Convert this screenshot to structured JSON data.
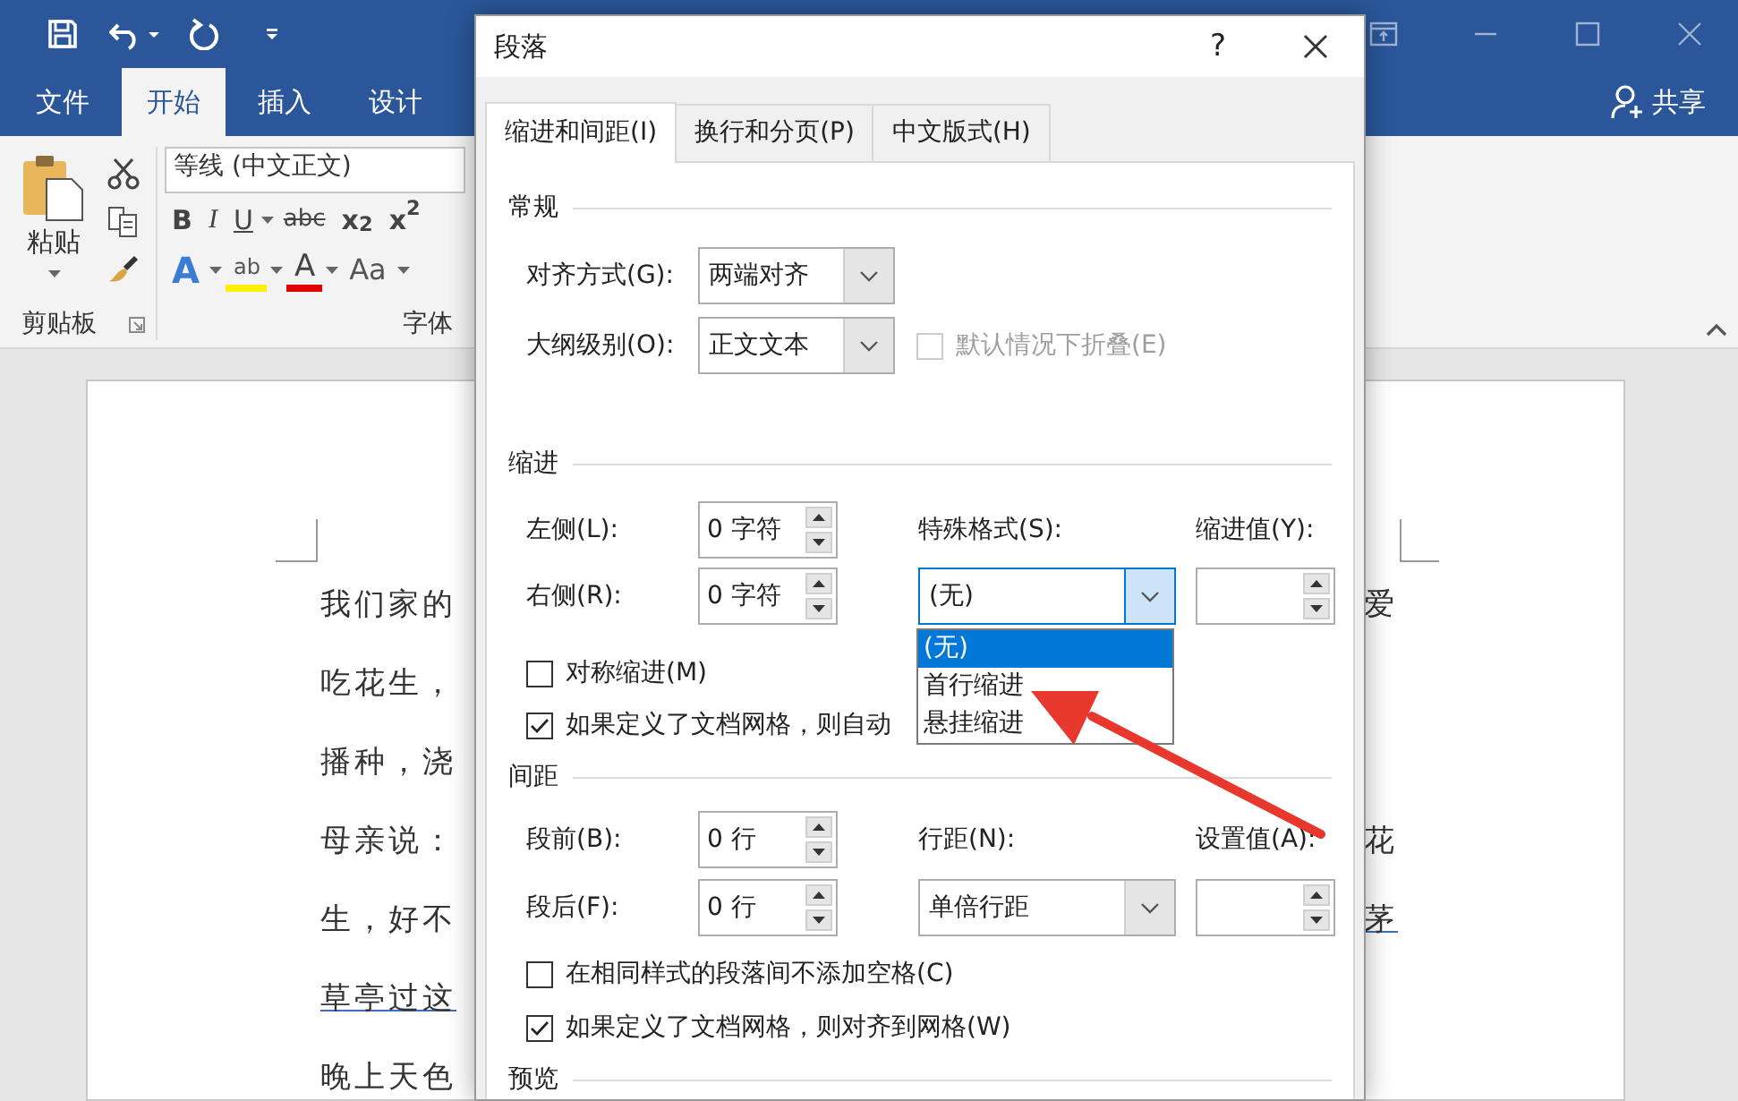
{
  "ribbon_tabs": [
    {
      "label": "文件",
      "selected": false
    },
    {
      "label": "开始",
      "selected": true
    },
    {
      "label": "插入",
      "selected": false
    },
    {
      "label": "设计",
      "selected": false
    }
  ],
  "share": "共享",
  "clipboard": {
    "paste": "粘贴",
    "group_label": "剪贴板"
  },
  "font_group": {
    "font_name": "等线 (中文正文)",
    "group_label": "字体",
    "format_buttons": [
      {
        "text": "B",
        "kind": "bold"
      },
      {
        "text": "I",
        "kind": "italic"
      },
      {
        "text": "U",
        "kind": "underline"
      },
      {
        "text": "abc",
        "kind": "strike"
      },
      {
        "text": "x$_{2}$",
        "kind": "sub"
      },
      {
        "text": "x$^{2}$",
        "kind": "sup"
      }
    ],
    "color_buttons": [
      {
        "text": "A",
        "kind": "effect"
      },
      {
        "text": "ab",
        "kind": "highlight"
      },
      {
        "text": "A",
        "kind": "color"
      },
      {
        "text": "Aa",
        "kind": "case"
      }
    ]
  },
  "document": {
    "lines": [
      {
        "left": {
          "text": "我们家的",
          "underlined": false
        },
        "right": {
          "text": "爱",
          "underlined": false
        }
      },
      {
        "left": {
          "text": "吃花生，",
          "underlined": false
        }
      },
      {
        "left": {
          "text": "播种，浇",
          "underlined": false
        }
      },
      {
        "left": {
          "text": "母亲说：",
          "underlined": false
        },
        "right": {
          "text": "花",
          "underlined": false
        }
      },
      {
        "left": {
          "text": "生，好不",
          "underlined": false
        },
        "right": {
          "text": "茅",
          "underlined": true
        }
      },
      {
        "left": {
          "text": "草亭过这",
          "underlined": true
        }
      },
      {
        "left": {
          "text": "晚上天色",
          "underlined": false
        }
      }
    ]
  },
  "dialog": {
    "title": "段落",
    "help": "?",
    "tabs": [
      {
        "label": "缩进和间距(I)",
        "selected": true
      },
      {
        "label": "换行和分页(P)",
        "selected": false
      },
      {
        "label": "中文版式(H)",
        "selected": false
      }
    ],
    "general": {
      "heading": "常规",
      "alignment": {
        "label": "对齐方式(G):",
        "value": "两端对齐"
      },
      "outline": {
        "label": "大纲级别(O):",
        "value": "正文文本"
      },
      "collapse": {
        "label": "默认情况下折叠(E)",
        "checked": false,
        "disabled": true
      }
    },
    "indent": {
      "heading": "缩进",
      "left": {
        "label": "左侧(L):",
        "value": "0 字符"
      },
      "right": {
        "label": "右侧(R):",
        "value": "0 字符"
      },
      "special": {
        "label": "特殊格式(S):",
        "value": "(无)",
        "expanded": true,
        "options": [
          {
            "label": "(无)",
            "selected": true
          },
          {
            "label": "首行缩进",
            "selected": false
          },
          {
            "label": "悬挂缩进",
            "selected": false
          }
        ]
      },
      "by": {
        "label": "缩进值(Y):"
      },
      "mirror": {
        "label": "对称缩进(M)",
        "checked": false,
        "disabled": false
      },
      "grid": {
        "label": "如果定义了文档网格，则自动",
        "checked": true,
        "disabled": false
      }
    },
    "spacing": {
      "heading": "间距",
      "before": {
        "label": "段前(B):",
        "value": "0 行"
      },
      "after": {
        "label": "段后(F):",
        "value": "0 行"
      },
      "line": {
        "label": "行距(N):",
        "value": "单倍行距",
        "expanded": false
      },
      "at": {
        "label": "设置值(A):"
      },
      "no_space": {
        "label": "在相同样式的段落间不添加空格(C)",
        "checked": false,
        "disabled": false
      },
      "snap": {
        "label": "如果定义了文档网格，则对齐到网格(W)",
        "checked": true,
        "disabled": false
      }
    },
    "preview": {
      "heading": "预览"
    }
  }
}
